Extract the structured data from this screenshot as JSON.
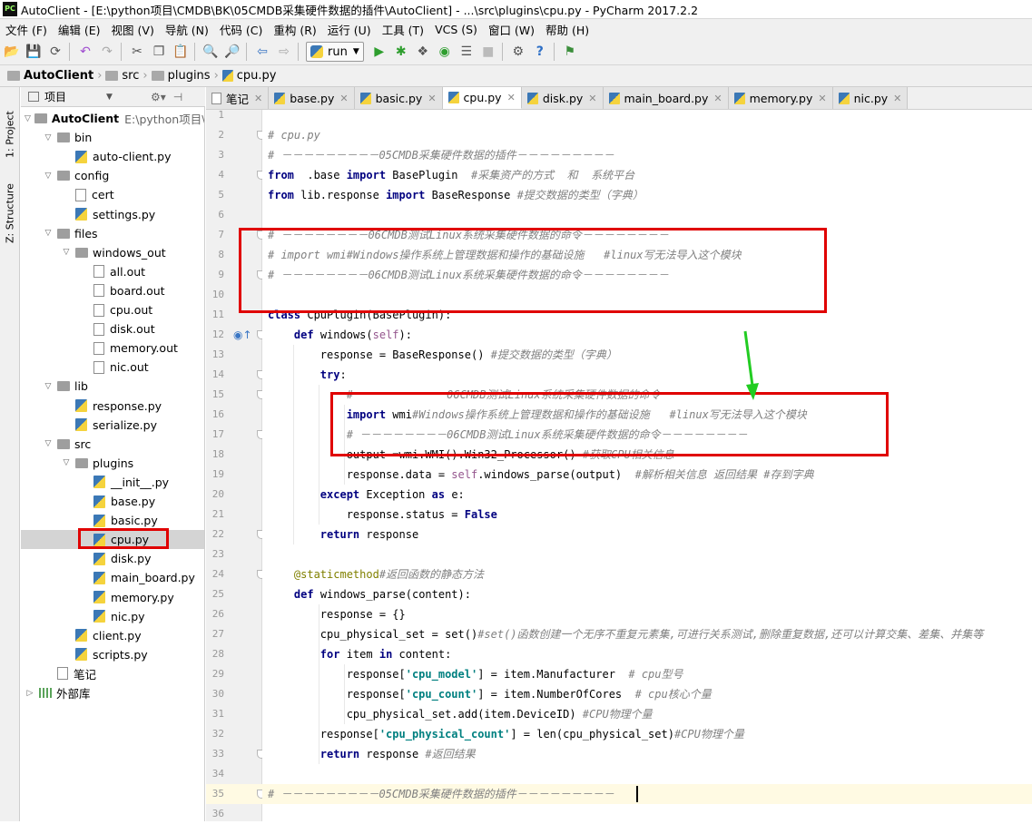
{
  "window_title": "AutoClient - [E:\\python项目\\CMDB\\BK\\05CMDB采集硬件数据的插件\\AutoClient] - ...\\src\\plugins\\cpu.py - PyCharm 2017.2.2",
  "logo_text": "PC",
  "menu": [
    "文件 (F)",
    "编辑 (E)",
    "视图 (V)",
    "导航 (N)",
    "代码 (C)",
    "重构 (R)",
    "运行 (U)",
    "工具 (T)",
    "VCS (S)",
    "窗口 (W)",
    "帮助 (H)"
  ],
  "toolbar": {
    "run_config": "run"
  },
  "breadcrumb": [
    "AutoClient",
    "src",
    "plugins",
    "cpu.py"
  ],
  "side_tabs": {
    "project": "1: Project",
    "structure": "Z: Structure"
  },
  "project_panel": {
    "title": "项目"
  },
  "tree": [
    {
      "label": "AutoClient",
      "extra": "E:\\python项目\\C",
      "kind": "root",
      "depth": 0,
      "arrow": "down"
    },
    {
      "label": "bin",
      "kind": "folder",
      "depth": 1,
      "arrow": "down"
    },
    {
      "label": "auto-client.py",
      "kind": "py",
      "depth": 2
    },
    {
      "label": "config",
      "kind": "folder",
      "depth": 1,
      "arrow": "down"
    },
    {
      "label": "cert",
      "kind": "txt",
      "depth": 2
    },
    {
      "label": "settings.py",
      "kind": "py",
      "depth": 2
    },
    {
      "label": "files",
      "kind": "folder",
      "depth": 1,
      "arrow": "down"
    },
    {
      "label": "windows_out",
      "kind": "folder",
      "depth": 2,
      "arrow": "down"
    },
    {
      "label": "all.out",
      "kind": "txt",
      "depth": 3
    },
    {
      "label": "board.out",
      "kind": "txt",
      "depth": 3
    },
    {
      "label": "cpu.out",
      "kind": "txt",
      "depth": 3
    },
    {
      "label": "disk.out",
      "kind": "txt",
      "depth": 3
    },
    {
      "label": "memory.out",
      "kind": "txt",
      "depth": 3
    },
    {
      "label": "nic.out",
      "kind": "txt",
      "depth": 3
    },
    {
      "label": "lib",
      "kind": "folder",
      "depth": 1,
      "arrow": "down"
    },
    {
      "label": "response.py",
      "kind": "py",
      "depth": 2
    },
    {
      "label": "serialize.py",
      "kind": "py",
      "depth": 2
    },
    {
      "label": "src",
      "kind": "folder",
      "depth": 1,
      "arrow": "down"
    },
    {
      "label": "plugins",
      "kind": "folder",
      "depth": 2,
      "arrow": "down"
    },
    {
      "label": "__init__.py",
      "kind": "py",
      "depth": 3
    },
    {
      "label": "base.py",
      "kind": "py",
      "depth": 3
    },
    {
      "label": "basic.py",
      "kind": "py",
      "depth": 3
    },
    {
      "label": "cpu.py",
      "kind": "py",
      "depth": 3,
      "selected": true
    },
    {
      "label": "disk.py",
      "kind": "py",
      "depth": 3
    },
    {
      "label": "main_board.py",
      "kind": "py",
      "depth": 3
    },
    {
      "label": "memory.py",
      "kind": "py",
      "depth": 3
    },
    {
      "label": "nic.py",
      "kind": "py",
      "depth": 3
    },
    {
      "label": "client.py",
      "kind": "py",
      "depth": 2
    },
    {
      "label": "scripts.py",
      "kind": "py",
      "depth": 2
    },
    {
      "label": "笔记",
      "kind": "txt",
      "depth": 1
    },
    {
      "label": "外部库",
      "kind": "lib",
      "depth": 0,
      "arrow": "right"
    }
  ],
  "tabs": [
    {
      "label": "笔记",
      "kind": "txt"
    },
    {
      "label": "base.py",
      "kind": "py"
    },
    {
      "label": "basic.py",
      "kind": "py"
    },
    {
      "label": "cpu.py",
      "kind": "py",
      "active": true
    },
    {
      "label": "disk.py",
      "kind": "py"
    },
    {
      "label": "main_board.py",
      "kind": "py"
    },
    {
      "label": "memory.py",
      "kind": "py"
    },
    {
      "label": "nic.py",
      "kind": "py"
    }
  ],
  "code": {
    "first_line": 1,
    "current_line": 35,
    "lines": [
      [],
      [
        [
          "c",
          "# cpu.py"
        ]
      ],
      [
        [
          "c",
          "# －－－－－－－－－05CMDB采集硬件数据的插件－－－－－－－－－"
        ]
      ],
      [
        [
          "k",
          "from"
        ],
        [
          "",
          "  .base "
        ],
        [
          "k",
          "import"
        ],
        [
          "",
          " BasePlugin  "
        ],
        [
          "c",
          "#采集资产的方式  和  系统平台"
        ]
      ],
      [
        [
          "k",
          "from"
        ],
        [
          "",
          " lib.response "
        ],
        [
          "k",
          "import"
        ],
        [
          "",
          " BaseResponse "
        ],
        [
          "c",
          "#提交数据的类型（字典）"
        ]
      ],
      [],
      [
        [
          "c",
          "# －－－－－－－－06CMDB测试Linux系统采集硬件数据的命令－－－－－－－－"
        ]
      ],
      [
        [
          "c",
          "# import wmi#Windows操作系统上管理数据和操作的基础设施   #linux写无法导入这个模块"
        ]
      ],
      [
        [
          "c",
          "# －－－－－－－－06CMDB测试Linux系统采集硬件数据的命令－－－－－－－－"
        ]
      ],
      [],
      [
        [
          "k",
          "class"
        ],
        [
          "",
          " CpuPlugin(BasePlugin):"
        ]
      ],
      [
        [
          "",
          "    "
        ],
        [
          "k",
          "def"
        ],
        [
          "",
          " windows("
        ],
        [
          "sf",
          "self"
        ],
        [
          "",
          "):"
        ]
      ],
      [
        [
          "",
          "        response = BaseResponse() "
        ],
        [
          "c",
          "#提交数据的类型（字典）"
        ]
      ],
      [
        [
          "",
          "        "
        ],
        [
          "k",
          "try"
        ],
        [
          "",
          ":"
        ]
      ],
      [
        [
          "",
          "            "
        ],
        [
          "c",
          "# －－－－－－－－06CMDB测试Linux系统采集硬件数据的命令－－－－－－－－"
        ]
      ],
      [
        [
          "",
          "            "
        ],
        [
          "k",
          "import"
        ],
        [
          "",
          " wmi"
        ],
        [
          "c",
          "#Windows操作系统上管理数据和操作的基础设施   #linux写无法导入这个模块"
        ]
      ],
      [
        [
          "",
          "            "
        ],
        [
          "c",
          "# －－－－－－－－06CMDB测试Linux系统采集硬件数据的命令－－－－－－－－"
        ]
      ],
      [
        [
          "",
          "            output =wmi.WMI().Win32_Processor() "
        ],
        [
          "c",
          "#获取CPU相关信息"
        ]
      ],
      [
        [
          "",
          "            response.data = "
        ],
        [
          "sf",
          "self"
        ],
        [
          "",
          ".windows_parse(output)  "
        ],
        [
          "c",
          "#解析相关信息 返回结果 #存到字典"
        ]
      ],
      [
        [
          "",
          "        "
        ],
        [
          "k",
          "except"
        ],
        [
          "",
          " Exception "
        ],
        [
          "k",
          "as"
        ],
        [
          "",
          " e:"
        ]
      ],
      [
        [
          "",
          "            response.status = "
        ],
        [
          "b",
          "False"
        ]
      ],
      [
        [
          "",
          "        "
        ],
        [
          "k",
          "return"
        ],
        [
          "",
          " response"
        ]
      ],
      [],
      [
        [
          "",
          "    "
        ],
        [
          "d",
          "@staticmethod"
        ],
        [
          "c",
          "#返回函数的静态方法"
        ]
      ],
      [
        [
          "",
          "    "
        ],
        [
          "k",
          "def"
        ],
        [
          "",
          " windows_parse(content):"
        ]
      ],
      [
        [
          "",
          "        response = {}"
        ]
      ],
      [
        [
          "",
          "        cpu_physical_set = set()"
        ],
        [
          "c",
          "#set()函数创建一个无序不重复元素集,可进行关系测试,删除重复数据,还可以计算交集、差集、并集等"
        ]
      ],
      [
        [
          "",
          "        "
        ],
        [
          "k",
          "for"
        ],
        [
          "",
          " item "
        ],
        [
          "k",
          "in"
        ],
        [
          "",
          " content:"
        ]
      ],
      [
        [
          "",
          "            response["
        ],
        [
          "s",
          "'cpu_model'"
        ],
        [
          "",
          "] = item.Manufacturer  "
        ],
        [
          "c",
          "# cpu型号"
        ]
      ],
      [
        [
          "",
          "            response["
        ],
        [
          "s",
          "'cpu_count'"
        ],
        [
          "",
          "] = item.NumberOfCores  "
        ],
        [
          "c",
          "# cpu核心个量"
        ]
      ],
      [
        [
          "",
          "            cpu_physical_set.add(item.DeviceID) "
        ],
        [
          "c",
          "#CPU物理个量"
        ]
      ],
      [
        [
          "",
          "        response["
        ],
        [
          "s",
          "'cpu_physical_count'"
        ],
        [
          "",
          "] = len(cpu_physical_set)"
        ],
        [
          "c",
          "#CPU物理个量"
        ]
      ],
      [
        [
          "",
          "        "
        ],
        [
          "k",
          "return"
        ],
        [
          "",
          " response "
        ],
        [
          "c",
          "#返回结果"
        ]
      ],
      [],
      [
        [
          "c",
          "# －－－－－－－－－05CMDB采集硬件数据的插件－－－－－－－－－"
        ]
      ],
      []
    ]
  }
}
